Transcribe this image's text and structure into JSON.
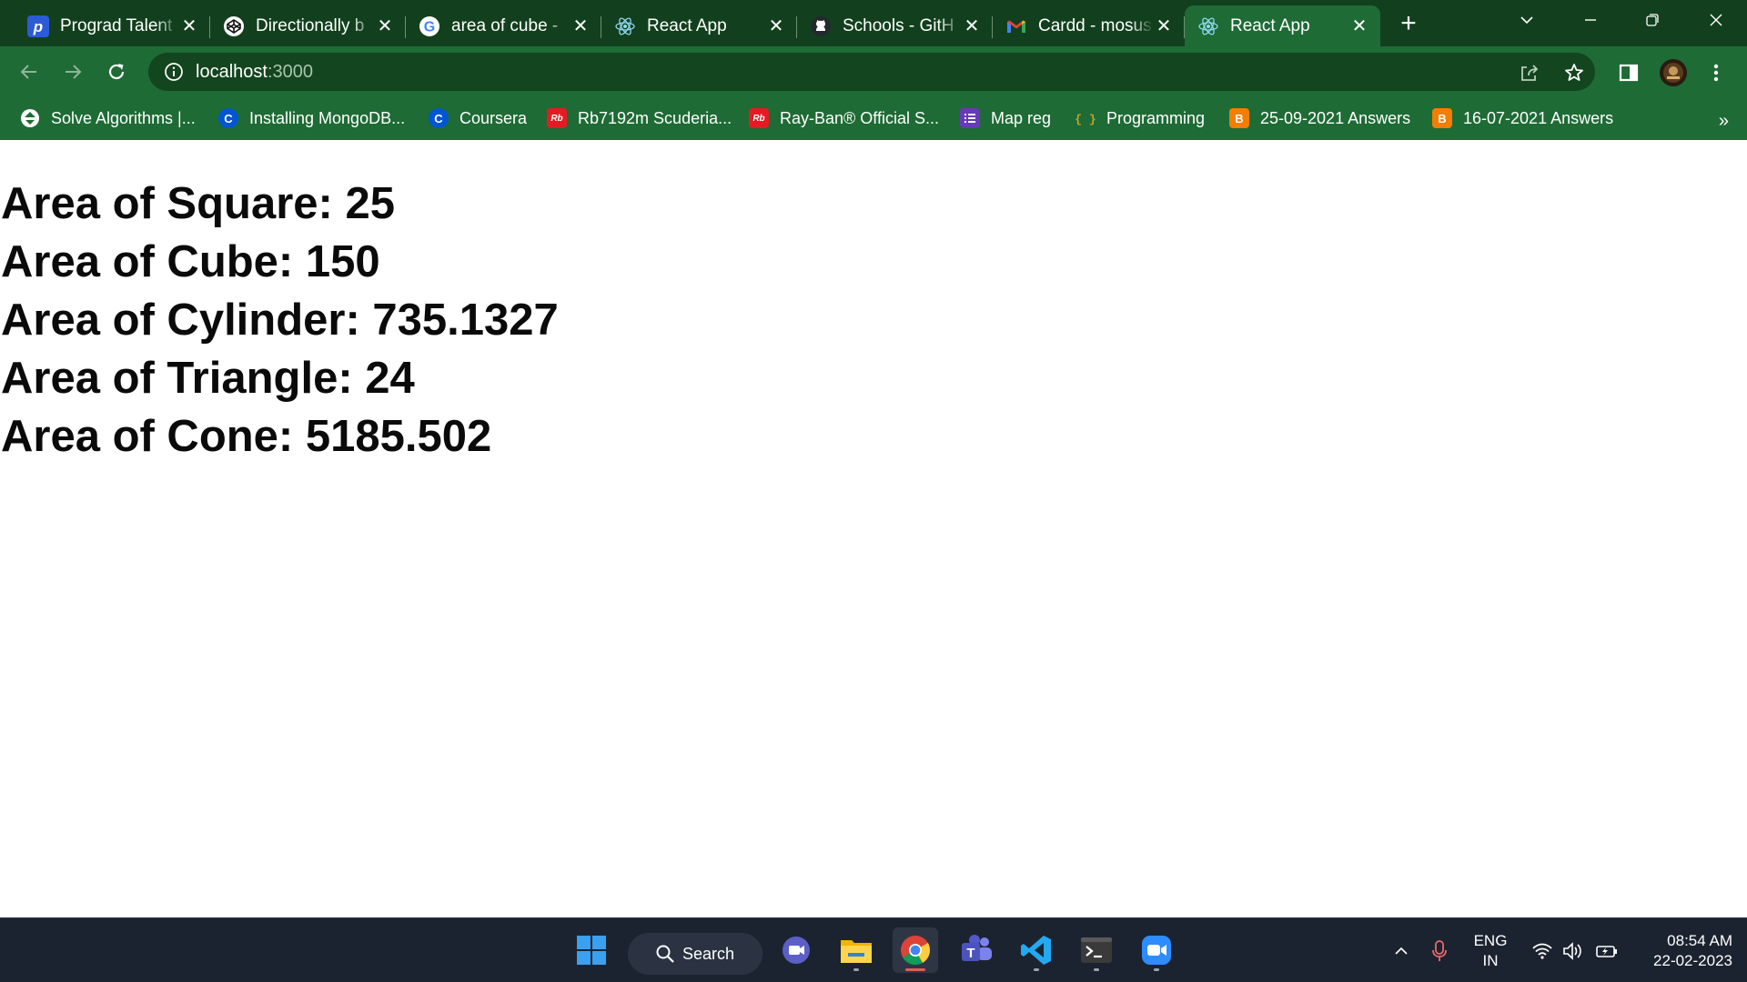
{
  "tabs": [
    {
      "title": "Prograd Talent",
      "icon": "prograd-icon"
    },
    {
      "title": "Directionally b",
      "icon": "codepen-icon"
    },
    {
      "title": "area of cube -",
      "icon": "google-icon"
    },
    {
      "title": "React App",
      "icon": "react-icon"
    },
    {
      "title": "Schools - GitH",
      "icon": "github-icon"
    },
    {
      "title": "Cardd - mosus",
      "icon": "gmail-icon"
    },
    {
      "title": "React App",
      "icon": "react-icon",
      "active": true
    }
  ],
  "close_glyph": "✕",
  "newtab_glyph": "+",
  "address": {
    "host": "localhost",
    "port": ":3000"
  },
  "bookmarks": [
    {
      "label": "Solve Algorithms |...",
      "icon": "hackerrank-icon"
    },
    {
      "label": "Installing MongoDB...",
      "icon": "coursera-icon"
    },
    {
      "label": "Coursera",
      "icon": "coursera-icon"
    },
    {
      "label": "Rb7192m Scuderia...",
      "icon": "rayban-icon"
    },
    {
      "label": "Ray-Ban® Official S...",
      "icon": "rayban-icon"
    },
    {
      "label": "Map reg",
      "icon": "form-icon"
    },
    {
      "label": "Programming",
      "icon": "folder-code-icon"
    },
    {
      "label": "25-09-2021 Answers",
      "icon": "blogger-icon"
    },
    {
      "label": "16-07-2021 Answers",
      "icon": "blogger-icon"
    }
  ],
  "bookmarks_more": "»",
  "results": [
    "Area of Square: 25",
    "Area of Cube: 150",
    "Area of Cylinder: 735.1327",
    "Area of Triangle: 24",
    "Area of Cone: 5185.502"
  ],
  "taskbar": {
    "search_label": "Search",
    "lang_line1": "ENG",
    "lang_line2": "IN",
    "time": "08:54 AM",
    "date": "22-02-2023"
  },
  "colors": {
    "frame": "#12401e",
    "toolbar": "#1e6b35",
    "taskbar": "#1c2330"
  }
}
